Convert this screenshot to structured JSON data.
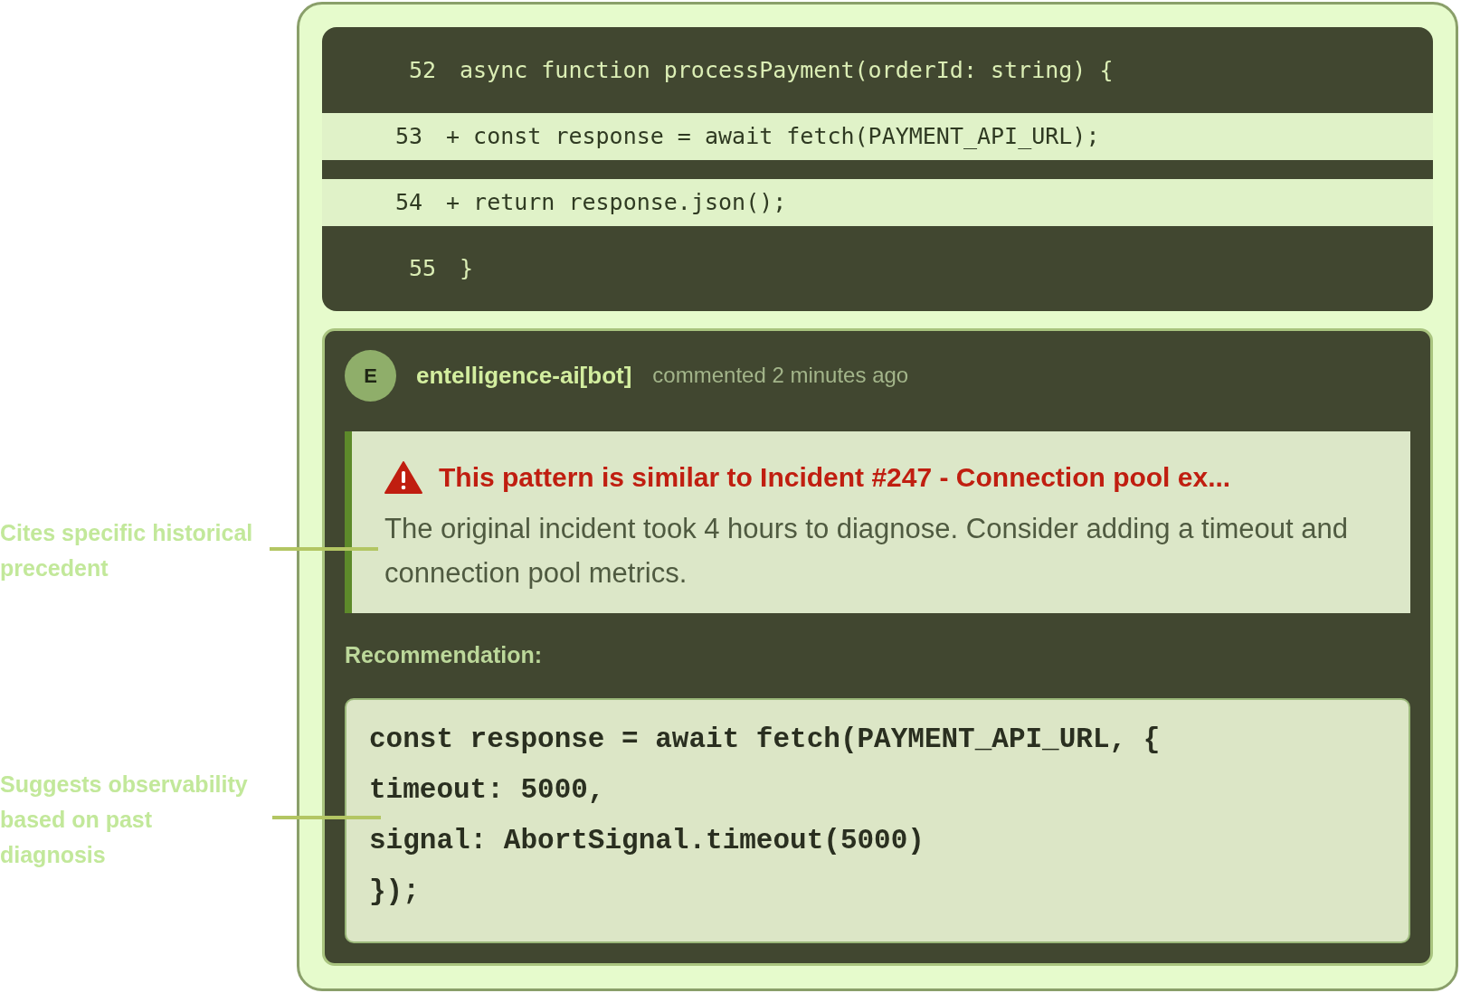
{
  "code_lines": [
    {
      "number": "52",
      "kind": "context",
      "text": "async function processPayment(orderId: string) {"
    },
    {
      "number": "53",
      "kind": "added",
      "text": "+ const response = await fetch(PAYMENT_API_URL);"
    },
    {
      "number": "54",
      "kind": "added",
      "text": "+ return response.json();"
    },
    {
      "number": "55",
      "kind": "context",
      "text": "}"
    }
  ],
  "comment": {
    "avatar": "E",
    "author": "entelligence-ai[bot]",
    "meta": "commented 2 minutes ago",
    "alert": {
      "title": "This pattern is similar to Incident #247 - Connection pool ex...",
      "body": "The original incident took 4 hours to diagnose. Consider adding a timeout and connection pool metrics."
    },
    "recommendation_label": "Recommendation:",
    "recommendation_code": [
      "const response = await fetch(PAYMENT_API_URL, {",
      "timeout: 5000,",
      "signal: AbortSignal.timeout(5000)",
      "});"
    ]
  },
  "annotations": [
    "Cites specific historical precedent",
    "Suggests observability based on past diagnosis"
  ]
}
